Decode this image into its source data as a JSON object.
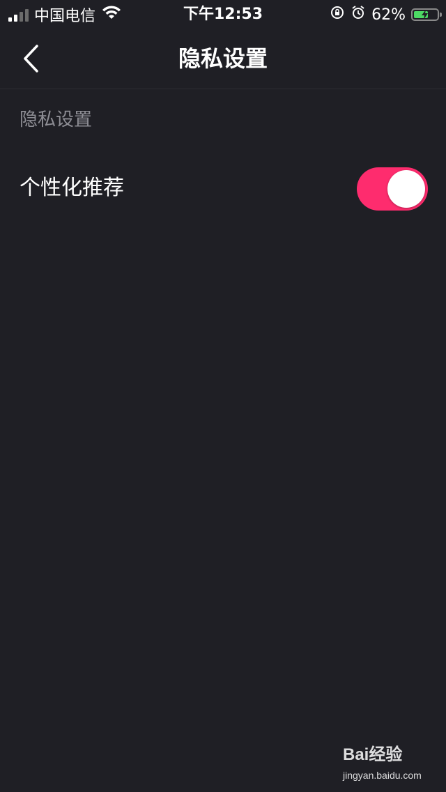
{
  "status_bar": {
    "carrier": "中国电信",
    "time": "下午12:53",
    "battery_percent": "62%",
    "battery_level": 0.62,
    "icons": [
      "signal-icon",
      "wifi-icon",
      "orientation-lock-icon",
      "alarm-icon",
      "battery-charging-icon"
    ]
  },
  "nav": {
    "title": "隐私设置",
    "back_icon": "chevron-left-icon"
  },
  "section": {
    "header": "隐私设置"
  },
  "settings": [
    {
      "label": "个性化推荐",
      "enabled": true
    }
  ],
  "watermark": {
    "brand": "Bai经验",
    "url": "jingyan.baidu.com"
  },
  "colors": {
    "background": "#1f1f25",
    "accent": "#fe2c6e",
    "muted_text": "#8e8e95"
  }
}
